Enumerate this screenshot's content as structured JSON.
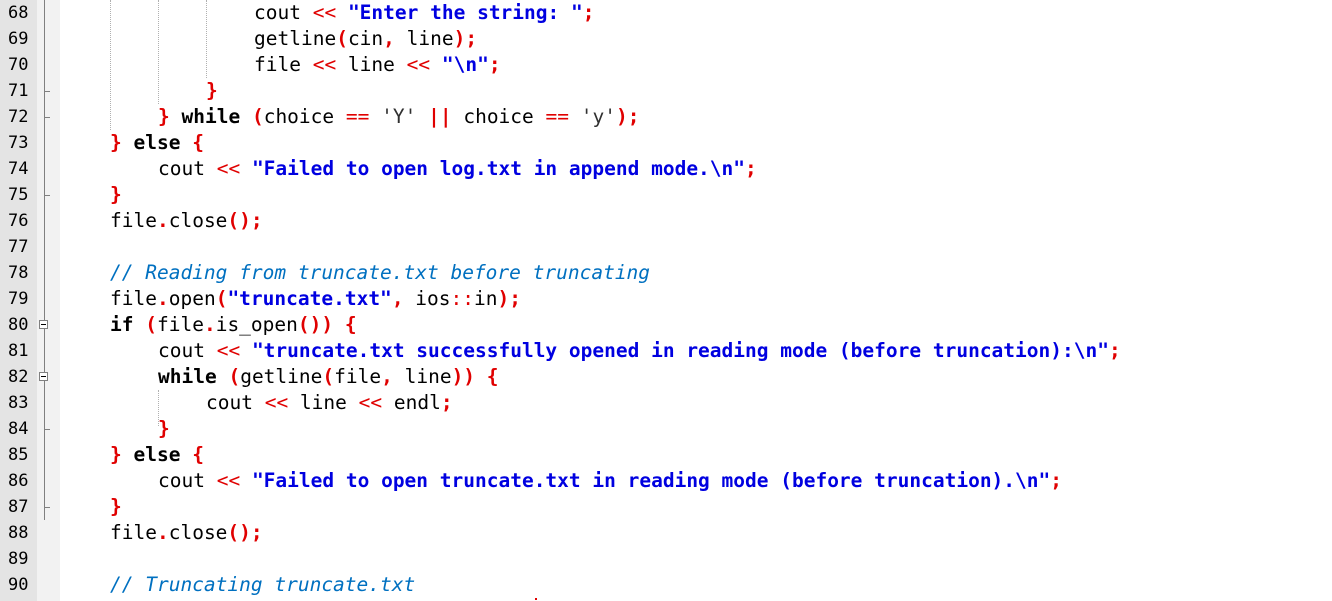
{
  "editor": {
    "lines": [
      {
        "number": "68",
        "tokens": [
          {
            "t": "cout ",
            "c": "id"
          },
          {
            "t": "<<",
            "c": "op"
          },
          {
            "t": " ",
            "c": "id"
          },
          {
            "t": "\"Enter the string: \"",
            "c": "str"
          },
          {
            "t": ";",
            "c": "br"
          }
        ]
      },
      {
        "number": "69",
        "tokens": [
          {
            "t": "getline",
            "c": "id"
          },
          {
            "t": "(",
            "c": "br"
          },
          {
            "t": "cin",
            "c": "id"
          },
          {
            "t": ",",
            "c": "br"
          },
          {
            "t": " line",
            "c": "id"
          },
          {
            "t": ");",
            "c": "br"
          }
        ]
      },
      {
        "number": "70",
        "tokens": [
          {
            "t": "file ",
            "c": "id"
          },
          {
            "t": "<<",
            "c": "op"
          },
          {
            "t": " line ",
            "c": "id"
          },
          {
            "t": "<<",
            "c": "op"
          },
          {
            "t": " ",
            "c": "id"
          },
          {
            "t": "\"\\n\"",
            "c": "str"
          },
          {
            "t": ";",
            "c": "br"
          }
        ]
      },
      {
        "number": "71",
        "tokens": [
          {
            "t": "}",
            "c": "br"
          }
        ]
      },
      {
        "number": "72",
        "tokens": [
          {
            "t": "}",
            "c": "br"
          },
          {
            "t": " while",
            "c": "kw"
          },
          {
            "t": " ",
            "c": "id"
          },
          {
            "t": "(",
            "c": "br"
          },
          {
            "t": "choice ",
            "c": "id"
          },
          {
            "t": "==",
            "c": "op"
          },
          {
            "t": " ",
            "c": "id"
          },
          {
            "t": "'Y'",
            "c": "chr"
          },
          {
            "t": " ",
            "c": "id"
          },
          {
            "t": "||",
            "c": "br"
          },
          {
            "t": " choice ",
            "c": "id"
          },
          {
            "t": "==",
            "c": "op"
          },
          {
            "t": " ",
            "c": "id"
          },
          {
            "t": "'y'",
            "c": "chr"
          },
          {
            "t": ");",
            "c": "br"
          }
        ]
      },
      {
        "number": "73",
        "tokens": [
          {
            "t": "}",
            "c": "br"
          },
          {
            "t": " else",
            "c": "kw"
          },
          {
            "t": " ",
            "c": "id"
          },
          {
            "t": "{",
            "c": "br"
          }
        ]
      },
      {
        "number": "74",
        "tokens": [
          {
            "t": "cout ",
            "c": "id"
          },
          {
            "t": "<<",
            "c": "op"
          },
          {
            "t": " ",
            "c": "id"
          },
          {
            "t": "\"Failed to open log.txt in append mode.\\n\"",
            "c": "str"
          },
          {
            "t": ";",
            "c": "br"
          }
        ]
      },
      {
        "number": "75",
        "tokens": [
          {
            "t": "}",
            "c": "br"
          }
        ]
      },
      {
        "number": "76",
        "tokens": [
          {
            "t": "file",
            "c": "id"
          },
          {
            "t": ".",
            "c": "br"
          },
          {
            "t": "close",
            "c": "id"
          },
          {
            "t": "();",
            "c": "br"
          }
        ]
      },
      {
        "number": "77",
        "tokens": []
      },
      {
        "number": "78",
        "tokens": [
          {
            "t": "// Reading from truncate.txt before truncating",
            "c": "cmt"
          }
        ]
      },
      {
        "number": "79",
        "tokens": [
          {
            "t": "file",
            "c": "id"
          },
          {
            "t": ".",
            "c": "br"
          },
          {
            "t": "open",
            "c": "id"
          },
          {
            "t": "(",
            "c": "br"
          },
          {
            "t": "\"truncate.txt\"",
            "c": "str"
          },
          {
            "t": ",",
            "c": "br"
          },
          {
            "t": " ios",
            "c": "id"
          },
          {
            "t": "::",
            "c": "op"
          },
          {
            "t": "in",
            "c": "id"
          },
          {
            "t": ");",
            "c": "br"
          }
        ]
      },
      {
        "number": "80",
        "tokens": [
          {
            "t": "if",
            "c": "kw"
          },
          {
            "t": " ",
            "c": "id"
          },
          {
            "t": "(",
            "c": "br"
          },
          {
            "t": "file",
            "c": "id"
          },
          {
            "t": ".",
            "c": "br"
          },
          {
            "t": "is_open",
            "c": "id"
          },
          {
            "t": "())",
            "c": "br"
          },
          {
            "t": " ",
            "c": "id"
          },
          {
            "t": "{",
            "c": "br"
          }
        ]
      },
      {
        "number": "81",
        "tokens": [
          {
            "t": "cout ",
            "c": "id"
          },
          {
            "t": "<<",
            "c": "op"
          },
          {
            "t": " ",
            "c": "id"
          },
          {
            "t": "\"truncate.txt successfully opened in reading mode (before truncation):\\n\"",
            "c": "str"
          },
          {
            "t": ";",
            "c": "br"
          }
        ]
      },
      {
        "number": "82",
        "tokens": [
          {
            "t": "while",
            "c": "kw"
          },
          {
            "t": " ",
            "c": "id"
          },
          {
            "t": "(",
            "c": "br"
          },
          {
            "t": "getline",
            "c": "id"
          },
          {
            "t": "(",
            "c": "br"
          },
          {
            "t": "file",
            "c": "id"
          },
          {
            "t": ",",
            "c": "br"
          },
          {
            "t": " line",
            "c": "id"
          },
          {
            "t": "))",
            "c": "br"
          },
          {
            "t": " ",
            "c": "id"
          },
          {
            "t": "{",
            "c": "br"
          }
        ]
      },
      {
        "number": "83",
        "tokens": [
          {
            "t": "cout ",
            "c": "id"
          },
          {
            "t": "<<",
            "c": "op"
          },
          {
            "t": " line ",
            "c": "id"
          },
          {
            "t": "<<",
            "c": "op"
          },
          {
            "t": " endl",
            "c": "id"
          },
          {
            "t": ";",
            "c": "br"
          }
        ]
      },
      {
        "number": "84",
        "tokens": [
          {
            "t": "}",
            "c": "br"
          }
        ]
      },
      {
        "number": "85",
        "tokens": [
          {
            "t": "}",
            "c": "br"
          },
          {
            "t": " else",
            "c": "kw"
          },
          {
            "t": " ",
            "c": "id"
          },
          {
            "t": "{",
            "c": "br"
          }
        ]
      },
      {
        "number": "86",
        "tokens": [
          {
            "t": "cout ",
            "c": "id"
          },
          {
            "t": "<<",
            "c": "op"
          },
          {
            "t": " ",
            "c": "id"
          },
          {
            "t": "\"Failed to open truncate.txt in reading mode (before truncation).\\n\"",
            "c": "str"
          },
          {
            "t": ";",
            "c": "br"
          }
        ]
      },
      {
        "number": "87",
        "tokens": [
          {
            "t": "}",
            "c": "br"
          }
        ]
      },
      {
        "number": "88",
        "tokens": [
          {
            "t": "file",
            "c": "id"
          },
          {
            "t": ".",
            "c": "br"
          },
          {
            "t": "close",
            "c": "id"
          },
          {
            "t": "();",
            "c": "br"
          }
        ]
      },
      {
        "number": "89",
        "tokens": []
      },
      {
        "number": "90",
        "tokens": [
          {
            "t": "// Truncating truncate.txt",
            "c": "cmt"
          }
        ]
      }
    ]
  }
}
